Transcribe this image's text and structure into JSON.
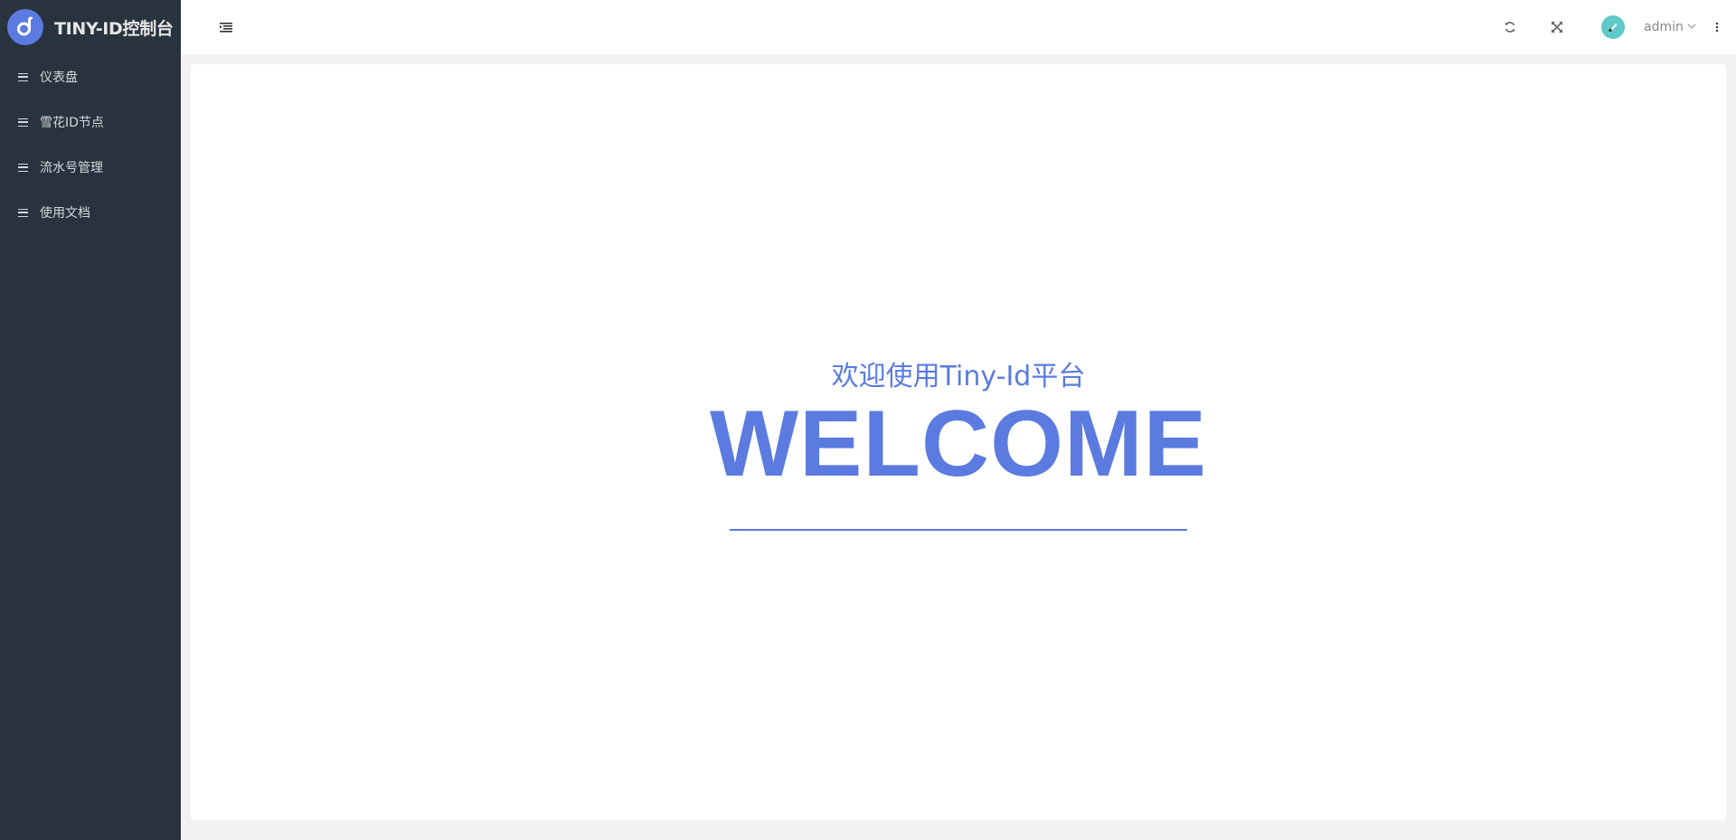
{
  "app": {
    "title": "TINY-ID控制台",
    "brand_color": "#5b7be0"
  },
  "sidebar": {
    "items": [
      {
        "label": "仪表盘",
        "icon": "menu-lines-icon"
      },
      {
        "label": "雪花ID节点",
        "icon": "menu-lines-icon"
      },
      {
        "label": "流水号管理",
        "icon": "menu-lines-icon"
      },
      {
        "label": "使用文档",
        "icon": "menu-lines-icon"
      }
    ]
  },
  "header": {
    "user_name": "admin",
    "icons": [
      "collapse-menu-icon",
      "refresh-icon",
      "fullscreen-icon",
      "avatar",
      "chevron-down-icon",
      "more-vertical-icon"
    ]
  },
  "main": {
    "subtitle": "欢迎使用Tiny-Id平台",
    "headline": "WELCOME"
  }
}
